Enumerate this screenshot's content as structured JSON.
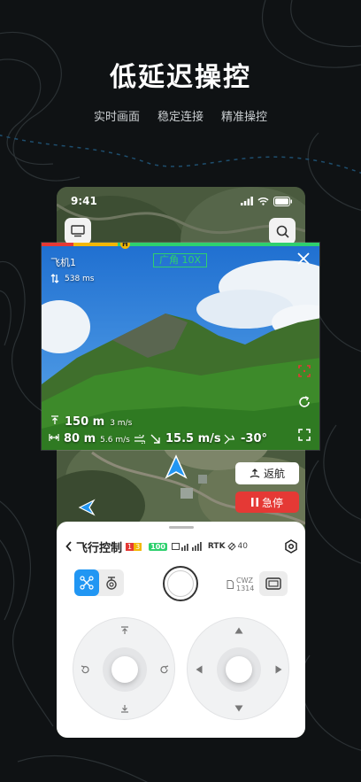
{
  "promo": {
    "headline": "低延迟操控",
    "features": [
      "实时画面",
      "稳定连接",
      "精准操控"
    ]
  },
  "status_bar": {
    "time": "9:41"
  },
  "video": {
    "aircraft_name": "飞机1",
    "latency": "538 ms",
    "lens_label": "广角 10X",
    "height_value": "150 m",
    "vertical_speed": "3 m/s",
    "distance_value": "80 m",
    "horizontal_speed": "5.6 m/s",
    "wind_speed": "15.5 m/s",
    "gimbal_pitch": "-30°",
    "home_marker": "H",
    "route_progress": 0.3
  },
  "map_actions": {
    "rth_label": "返航",
    "emergency_stop_label": "急停"
  },
  "panel": {
    "title": "飞行控制",
    "badge_red": "1",
    "badge_yellow": "3",
    "battery": "100",
    "rtk_label": "RTK",
    "satellite_count": "40",
    "sd_line1": "CWZ",
    "sd_line2": "1314"
  },
  "colors": {
    "accent_green": "#2ed06e",
    "danger_red": "#e53935",
    "primary_blue": "#2196f3",
    "warning_yellow": "#f2b705"
  }
}
